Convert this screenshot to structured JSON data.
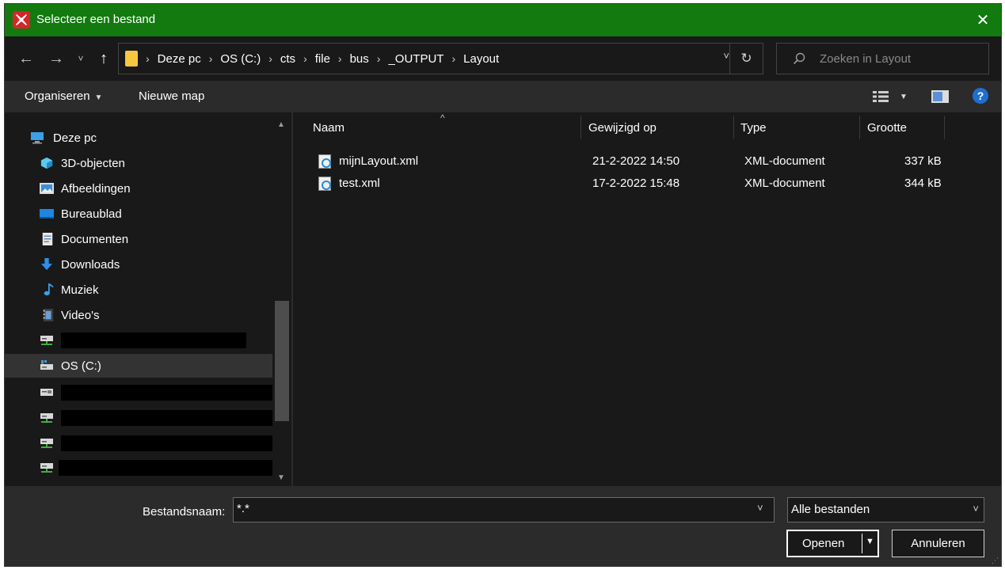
{
  "window": {
    "title": "Selecteer een bestand",
    "accent_color": "#127a0f",
    "icons": {
      "app": "red-x-app-icon",
      "close": "close-icon"
    }
  },
  "navigation": {
    "back": "←",
    "forward": "→",
    "recent": "˅",
    "up": "↑",
    "breadcrumbs": [
      "Deze pc",
      "OS (C:)",
      "cts",
      "file",
      "bus",
      "_OUTPUT",
      "Layout"
    ],
    "dropdown": "˅",
    "refresh": "↻",
    "search_placeholder": "Zoeken in Layout"
  },
  "commandbar": {
    "organize": "Organiseren",
    "new_folder": "Nieuwe map",
    "help": "?"
  },
  "sidebar": {
    "items": [
      {
        "label": "Deze pc",
        "icon": "computer-icon"
      },
      {
        "label": "3D-objecten",
        "icon": "cube-icon"
      },
      {
        "label": "Afbeeldingen",
        "icon": "pictures-icon"
      },
      {
        "label": "Bureaublad",
        "icon": "desktop-icon"
      },
      {
        "label": "Documenten",
        "icon": "documents-icon"
      },
      {
        "label": "Downloads",
        "icon": "download-icon"
      },
      {
        "label": "Muziek",
        "icon": "music-icon"
      },
      {
        "label": "Video's",
        "icon": "video-icon"
      },
      {
        "label": "",
        "icon": "network-drive-icon",
        "redacted": true
      },
      {
        "label": "OS (C:)",
        "icon": "drive-icon",
        "selected": true
      },
      {
        "label": "",
        "icon": "network-drive-icon",
        "redacted": true
      },
      {
        "label": "",
        "icon": "network-drive-icon",
        "redacted": true
      },
      {
        "label": "",
        "icon": "network-drive-icon",
        "redacted": true
      },
      {
        "label": "",
        "icon": "network-drive-icon",
        "redacted": true
      }
    ]
  },
  "filelist": {
    "columns": [
      "Naam",
      "Gewijzigd op",
      "Type",
      "Grootte"
    ],
    "rows": [
      {
        "name": "mijnLayout.xml",
        "modified": "21-2-2022 14:50",
        "type": "XML-document",
        "size": "337 kB"
      },
      {
        "name": "test.xml",
        "modified": "17-2-2022 15:48",
        "type": "XML-document",
        "size": "344 kB"
      }
    ]
  },
  "footer": {
    "filename_label": "Bestandsnaam:",
    "filename_value": "*.*",
    "filter_value": "Alle bestanden",
    "open_label": "Openen",
    "cancel_label": "Annuleren"
  }
}
